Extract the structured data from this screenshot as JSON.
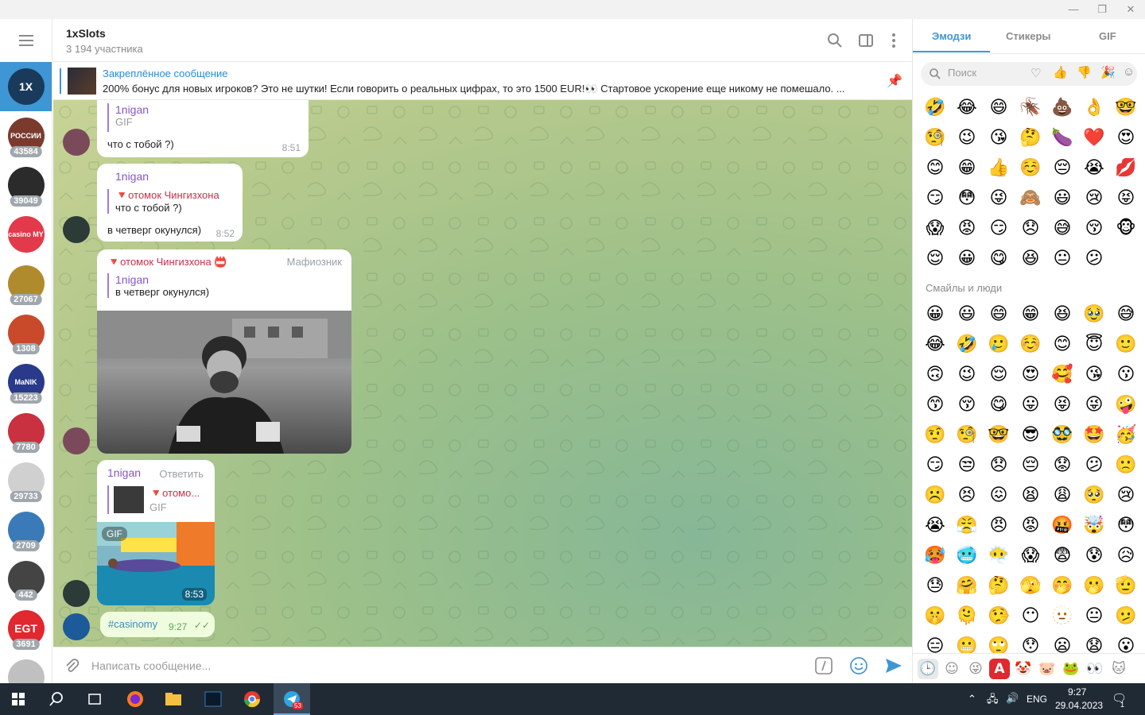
{
  "window": {
    "minimize": "—",
    "maximize": "❐",
    "close": "✕"
  },
  "rail": {
    "items": [
      {
        "label": "1X",
        "color": "#1a3a5c",
        "count": ""
      },
      {
        "label": "РОССИИ",
        "color": "#7a3b2e",
        "count": "43584"
      },
      {
        "label": "",
        "color": "#2b2b2b",
        "count": "39049"
      },
      {
        "label": "casino MY",
        "color": "#e23a4a",
        "count": ""
      },
      {
        "label": "",
        "color": "#b08b2e",
        "count": "27067"
      },
      {
        "label": "",
        "color": "#c84a2a",
        "count": "1308"
      },
      {
        "label": "MaNIK",
        "color": "#2a3a8a",
        "count": "15223"
      },
      {
        "label": "",
        "color": "#c93040",
        "count": "7780"
      },
      {
        "label": "",
        "color": "#d0d0d0",
        "count": "29733"
      },
      {
        "label": "",
        "color": "#3a7ab8",
        "count": "2709"
      },
      {
        "label": "",
        "color": "#444",
        "count": "442"
      },
      {
        "label": "EGT",
        "color": "#e0282e",
        "count": "3691"
      },
      {
        "label": "",
        "color": "#c0c0c0",
        "count": ""
      }
    ]
  },
  "chat": {
    "title": "1xSlots",
    "subtitle": "3 194 участника",
    "pinned_title": "Закреплённое сообщение",
    "pinned_text": "200% бонус для новых игроков? Это не шутки! Если говорить о реальных цифрах, то это 1500 EUR!👀  Стартовое ускорение еще никому не помешало. ...",
    "messages": {
      "m1": {
        "sender": "1nigan",
        "reply_type": "GIF",
        "text": "что с тобой ?)",
        "time": "8:51"
      },
      "m2": {
        "sender": "1nigan",
        "reply_name": "🔻отомок Чингизхона",
        "reply_text": "что с тобой ?)",
        "text": "в четверг окунулся)",
        "time": "8:52"
      },
      "m3": {
        "sender": "🔻отомок Чингизхона 📛",
        "role": "Мафиозник",
        "reply_name": "1nigan",
        "reply_text": "в четверг окунулся)"
      },
      "m4": {
        "sender": "1nigan",
        "action": "Ответить",
        "reply_name": "🔻отомо...",
        "reply_type": "GIF",
        "gif_badge": "GIF",
        "time": "8:53"
      },
      "m5": {
        "text": "#casinomy",
        "time": "9:27",
        "check": "✓✓"
      }
    },
    "composer_placeholder": "Написать сообщение..."
  },
  "emoji": {
    "tabs": [
      "Эмодзи",
      "Стикеры",
      "GIF"
    ],
    "search_placeholder": "Поиск",
    "section_title": "Смайлы и люди",
    "recent": [
      "🤣",
      "😂",
      "😄",
      "🪳",
      "💩",
      "👌",
      "🤓",
      "🧐",
      "😉",
      "😘",
      "🤔",
      "🍆",
      "❤️",
      "😍",
      "😊",
      "😁",
      "👍",
      "☺️",
      "😔",
      "😭",
      "💋",
      "😏",
      "😳",
      "😜",
      "🙈",
      "😃",
      "😢",
      "😝",
      "😱",
      "😡",
      "😏",
      "😞",
      "😅",
      "😚",
      "🐵",
      "😌",
      "😀",
      "😋",
      "😆",
      "😐",
      "😕"
    ],
    "people": [
      "😀",
      "😃",
      "😄",
      "😁",
      "😆",
      "🥹",
      "😅",
      "😂",
      "🤣",
      "🥲",
      "☺️",
      "😊",
      "😇",
      "🙂",
      "🙃",
      "😉",
      "😌",
      "😍",
      "🥰",
      "😘",
      "😗",
      "😙",
      "😚",
      "😋",
      "😛",
      "😝",
      "😜",
      "🤪",
      "🤨",
      "🧐",
      "🤓",
      "😎",
      "🥸",
      "🤩",
      "🥳",
      "😏",
      "😒",
      "😞",
      "😔",
      "😟",
      "😕",
      "🙁",
      "☹️",
      "😣",
      "😖",
      "😫",
      "😩",
      "🥺",
      "😢",
      "😭",
      "😤",
      "😠",
      "😡",
      "🤬",
      "🤯",
      "😳",
      "🥵",
      "🥶",
      "😶‍🌫️",
      "😱",
      "😨",
      "😰",
      "😥",
      "😓",
      "🤗",
      "🤔",
      "🫣",
      "🤭",
      "🫢",
      "🫡",
      "🤫",
      "🫠",
      "🤥",
      "😶",
      "🫥",
      "😐",
      "🫤",
      "😑",
      "😬",
      "🙄",
      "😯",
      "😦",
      "😧",
      "😮"
    ],
    "footer": [
      "🕒",
      "☺",
      "😜",
      "A",
      "🤡",
      "🐷",
      "🐸",
      "👀",
      "🐱"
    ]
  },
  "taskbar": {
    "lang": "ENG",
    "time": "9:27",
    "date": "29.04.2023",
    "tg_badge": "53",
    "notif": "1"
  }
}
